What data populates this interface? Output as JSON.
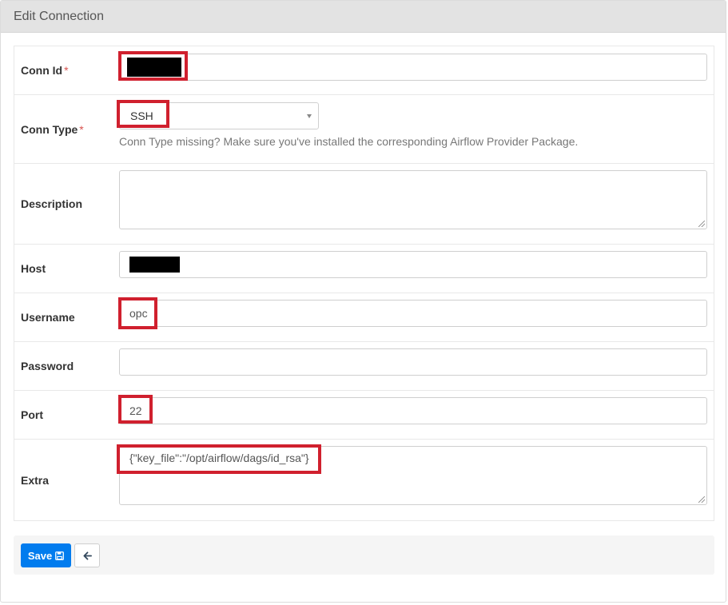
{
  "panel": {
    "title": "Edit Connection"
  },
  "fields": {
    "conn_id": {
      "label": "Conn Id",
      "required_mark": "*",
      "value": ""
    },
    "conn_type": {
      "label": "Conn Type",
      "required_mark": "*",
      "value": "SSH",
      "help": "Conn Type missing? Make sure you've installed the corresponding Airflow Provider Package."
    },
    "description": {
      "label": "Description",
      "value": ""
    },
    "host": {
      "label": "Host",
      "value": ""
    },
    "username": {
      "label": "Username",
      "value": "opc"
    },
    "password": {
      "label": "Password",
      "value": ""
    },
    "port": {
      "label": "Port",
      "value": "22"
    },
    "extra": {
      "label": "Extra",
      "value": "{\"key_file\":\"/opt/airflow/dags/id_rsa\"}"
    }
  },
  "actions": {
    "save_label": "Save"
  },
  "colors": {
    "save_button": "#017cee",
    "highlight": "#d0202e",
    "required": "#d9534f"
  },
  "icons": {
    "save": "floppy-disk-icon",
    "back": "arrow-left-icon",
    "dropdown": "caret-down-icon"
  }
}
